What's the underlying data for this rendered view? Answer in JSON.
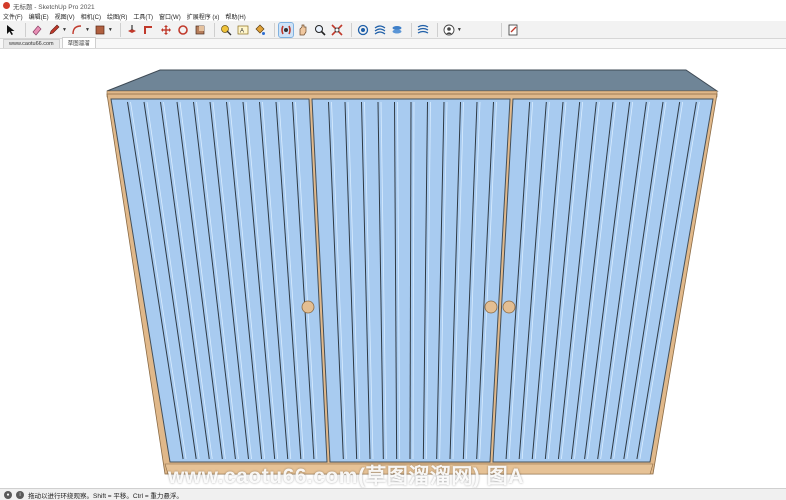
{
  "window": {
    "title": "无标题 - SketchUp Pro 2021"
  },
  "menu": [
    {
      "label": "文件(F)"
    },
    {
      "label": "编辑(E)"
    },
    {
      "label": "视图(V)"
    },
    {
      "label": "相机(C)"
    },
    {
      "label": "绘图(R)"
    },
    {
      "label": "工具(T)"
    },
    {
      "label": "窗口(W)"
    },
    {
      "label": "扩展程序 (x)"
    },
    {
      "label": "帮助(H)"
    }
  ],
  "toolbar": {
    "tools": [
      "select-icon",
      "eraser-icon",
      "pencil-icon",
      "arc-icon",
      "rectangle-icon",
      "push-pull-icon",
      "follow-me-icon",
      "move-icon",
      "rotate-icon",
      "scale-icon",
      "tape-measure-icon",
      "text-icon",
      "paint-bucket-icon",
      "orbit-icon",
      "pan-icon",
      "zoom-icon",
      "zoom-extents-icon",
      "warehouse-icon",
      "extension-warehouse-icon",
      "layout-icon",
      "extension-manager-icon",
      "user-icon",
      "model-info-icon"
    ]
  },
  "scenes": {
    "tabs": [
      "www.caotu66.com",
      "草图溜溜"
    ]
  },
  "status": {
    "text": "拖动以进行环绕观察。Shift = 平移。Ctrl = 重力悬浮。"
  },
  "watermark": {
    "text": "www.caotu66.com(草图溜溜网) 图A"
  },
  "colors": {
    "door_fill": "#a8cbf0",
    "door_groove": "#2f3a44",
    "frame": "#e0b88a",
    "top": "#6f8597",
    "handle": "#e3be92"
  }
}
